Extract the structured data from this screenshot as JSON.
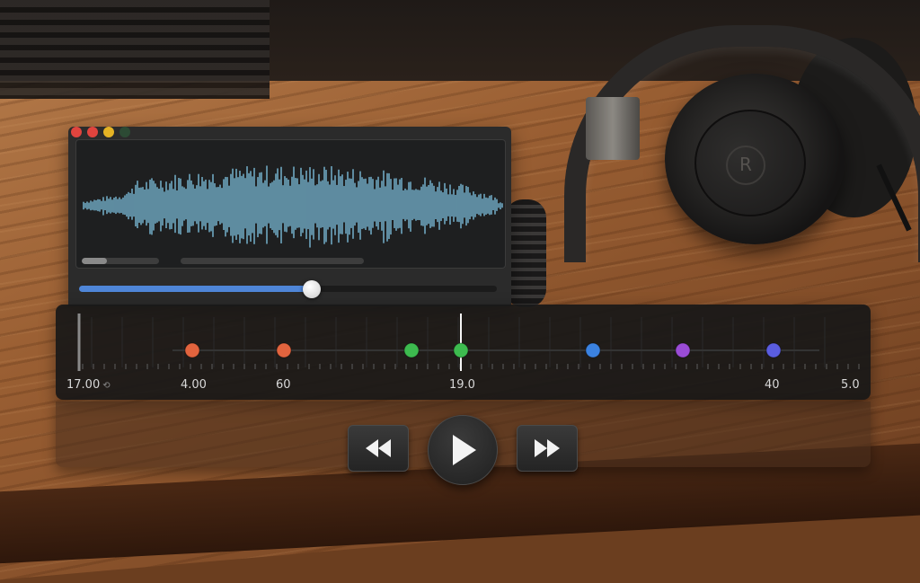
{
  "window": {
    "controls": [
      {
        "name": "close-dot",
        "color": "#e0443e"
      },
      {
        "name": "minimize-dot",
        "color": "#e0443e"
      },
      {
        "name": "maximize-dot",
        "color": "#e5b324"
      },
      {
        "name": "extra-dot",
        "color": "#2c4a34"
      }
    ],
    "waveform_color": "#6ea7c0",
    "position_progress": 0.557
  },
  "timeline": {
    "tick_labels": [
      "17.00",
      "4.00",
      "60",
      "19.0",
      "40",
      "5.0"
    ],
    "playhead_label": "19.0",
    "markers": [
      {
        "color": "#e2643e"
      },
      {
        "color": "#e2643e"
      },
      {
        "color": "#3dbb4f"
      },
      {
        "color": "#3dbb4f"
      },
      {
        "color": "#3b82e0"
      },
      {
        "color": "#9a4cd6"
      },
      {
        "color": "#5a5de0"
      }
    ]
  },
  "transport": {
    "rewind_icon": "rewind-icon",
    "play_icon": "play-icon",
    "forward_icon": "fast-forward-icon"
  },
  "headphones_logo": "R"
}
